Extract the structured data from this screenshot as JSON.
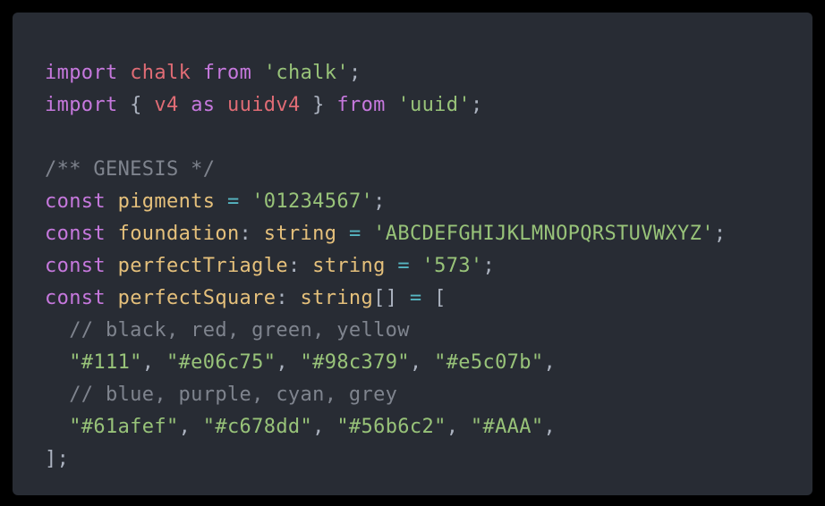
{
  "code_lines": [
    [
      {
        "text": "import",
        "kind": "keyword"
      },
      {
        "text": " ",
        "kind": "punct"
      },
      {
        "text": "chalk",
        "kind": "variable"
      },
      {
        "text": " ",
        "kind": "punct"
      },
      {
        "text": "from",
        "kind": "keyword"
      },
      {
        "text": " ",
        "kind": "punct"
      },
      {
        "text": "'chalk'",
        "kind": "string"
      },
      {
        "text": ";",
        "kind": "punct"
      }
    ],
    [
      {
        "text": "import",
        "kind": "keyword"
      },
      {
        "text": " { ",
        "kind": "punct"
      },
      {
        "text": "v4",
        "kind": "variable"
      },
      {
        "text": " ",
        "kind": "punct"
      },
      {
        "text": "as",
        "kind": "keyword"
      },
      {
        "text": " ",
        "kind": "punct"
      },
      {
        "text": "uuidv4",
        "kind": "variable"
      },
      {
        "text": " } ",
        "kind": "punct"
      },
      {
        "text": "from",
        "kind": "keyword"
      },
      {
        "text": " ",
        "kind": "punct"
      },
      {
        "text": "'uuid'",
        "kind": "string"
      },
      {
        "text": ";",
        "kind": "punct"
      }
    ],
    [],
    [
      {
        "text": "/** GENESIS */",
        "kind": "comment"
      }
    ],
    [
      {
        "text": "const",
        "kind": "keyword"
      },
      {
        "text": " ",
        "kind": "punct"
      },
      {
        "text": "pigments",
        "kind": "decl"
      },
      {
        "text": " ",
        "kind": "punct"
      },
      {
        "text": "=",
        "kind": "operator"
      },
      {
        "text": " ",
        "kind": "punct"
      },
      {
        "text": "'01234567'",
        "kind": "string"
      },
      {
        "text": ";",
        "kind": "punct"
      }
    ],
    [
      {
        "text": "const",
        "kind": "keyword"
      },
      {
        "text": " ",
        "kind": "punct"
      },
      {
        "text": "foundation",
        "kind": "decl"
      },
      {
        "text": ": ",
        "kind": "punct"
      },
      {
        "text": "string",
        "kind": "decl"
      },
      {
        "text": " ",
        "kind": "punct"
      },
      {
        "text": "=",
        "kind": "operator"
      },
      {
        "text": " ",
        "kind": "punct"
      },
      {
        "text": "'ABCDEFGHIJKLMNOPQRSTUVWXYZ'",
        "kind": "string"
      },
      {
        "text": ";",
        "kind": "punct"
      }
    ],
    [
      {
        "text": "const",
        "kind": "keyword"
      },
      {
        "text": " ",
        "kind": "punct"
      },
      {
        "text": "perfectTriagle",
        "kind": "decl"
      },
      {
        "text": ": ",
        "kind": "punct"
      },
      {
        "text": "string",
        "kind": "decl"
      },
      {
        "text": " ",
        "kind": "punct"
      },
      {
        "text": "=",
        "kind": "operator"
      },
      {
        "text": " ",
        "kind": "punct"
      },
      {
        "text": "'573'",
        "kind": "string"
      },
      {
        "text": ";",
        "kind": "punct"
      }
    ],
    [
      {
        "text": "const",
        "kind": "keyword"
      },
      {
        "text": " ",
        "kind": "punct"
      },
      {
        "text": "perfectSquare",
        "kind": "decl"
      },
      {
        "text": ": ",
        "kind": "punct"
      },
      {
        "text": "string",
        "kind": "decl"
      },
      {
        "text": "[] ",
        "kind": "punct"
      },
      {
        "text": "=",
        "kind": "operator"
      },
      {
        "text": " [",
        "kind": "punct"
      }
    ],
    [
      {
        "text": "  ",
        "kind": "punct"
      },
      {
        "text": "// black, red, green, yellow",
        "kind": "comment"
      }
    ],
    [
      {
        "text": "  ",
        "kind": "punct"
      },
      {
        "text": "\"#111\"",
        "kind": "string"
      },
      {
        "text": ", ",
        "kind": "punct"
      },
      {
        "text": "\"#e06c75\"",
        "kind": "string"
      },
      {
        "text": ", ",
        "kind": "punct"
      },
      {
        "text": "\"#98c379\"",
        "kind": "string"
      },
      {
        "text": ", ",
        "kind": "punct"
      },
      {
        "text": "\"#e5c07b\"",
        "kind": "string"
      },
      {
        "text": ",",
        "kind": "punct"
      }
    ],
    [
      {
        "text": "  ",
        "kind": "punct"
      },
      {
        "text": "// blue, purple, cyan, grey",
        "kind": "comment"
      }
    ],
    [
      {
        "text": "  ",
        "kind": "punct"
      },
      {
        "text": "\"#61afef\"",
        "kind": "string"
      },
      {
        "text": ", ",
        "kind": "punct"
      },
      {
        "text": "\"#c678dd\"",
        "kind": "string"
      },
      {
        "text": ", ",
        "kind": "punct"
      },
      {
        "text": "\"#56b6c2\"",
        "kind": "string"
      },
      {
        "text": ", ",
        "kind": "punct"
      },
      {
        "text": "\"#AAA\"",
        "kind": "string"
      },
      {
        "text": ",",
        "kind": "punct"
      }
    ],
    [
      {
        "text": "];",
        "kind": "punct"
      }
    ]
  ]
}
